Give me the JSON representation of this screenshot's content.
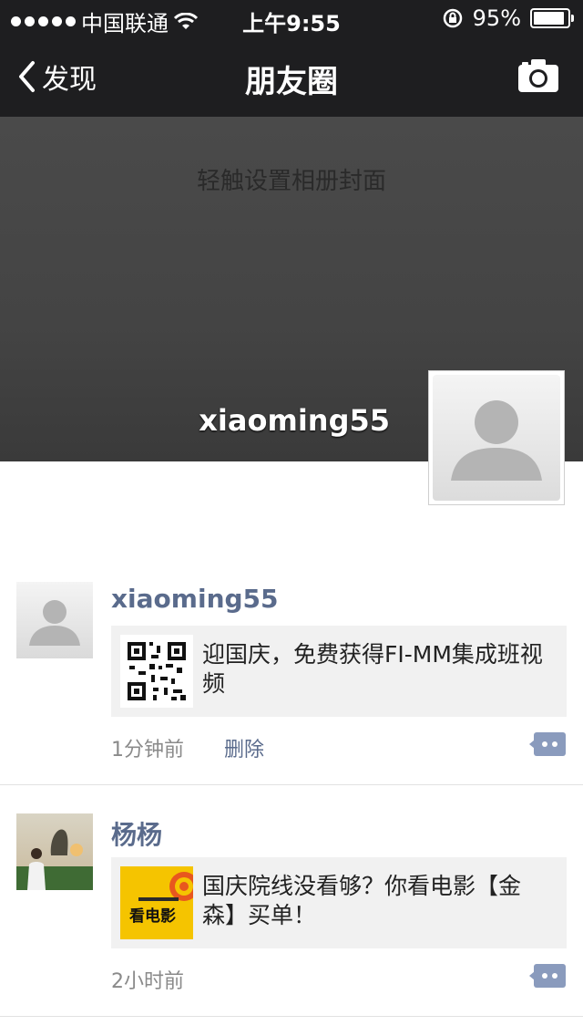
{
  "status_bar": {
    "carrier": "中国联通",
    "time": "上午9:55",
    "battery": "95%"
  },
  "nav": {
    "back_label": "发现",
    "title": "朋友圈"
  },
  "cover": {
    "hint": "轻触设置相册封面",
    "username": "xiaoming55"
  },
  "feed": [
    {
      "name": "xiaoming55",
      "text": "迎国庆，免费获得FI-MM集成班视频",
      "time": "1分钟前",
      "delete_label": "删除"
    },
    {
      "name": "杨杨",
      "text": "国庆院线没看够？你看电影【金森】买单！",
      "time": "2小时前",
      "thumb_text": "看电影"
    }
  ],
  "colors": {
    "bar_bg": "#1e1e20",
    "link_blue": "#5a6b8c",
    "thumb_yellow": "#f5c400"
  }
}
